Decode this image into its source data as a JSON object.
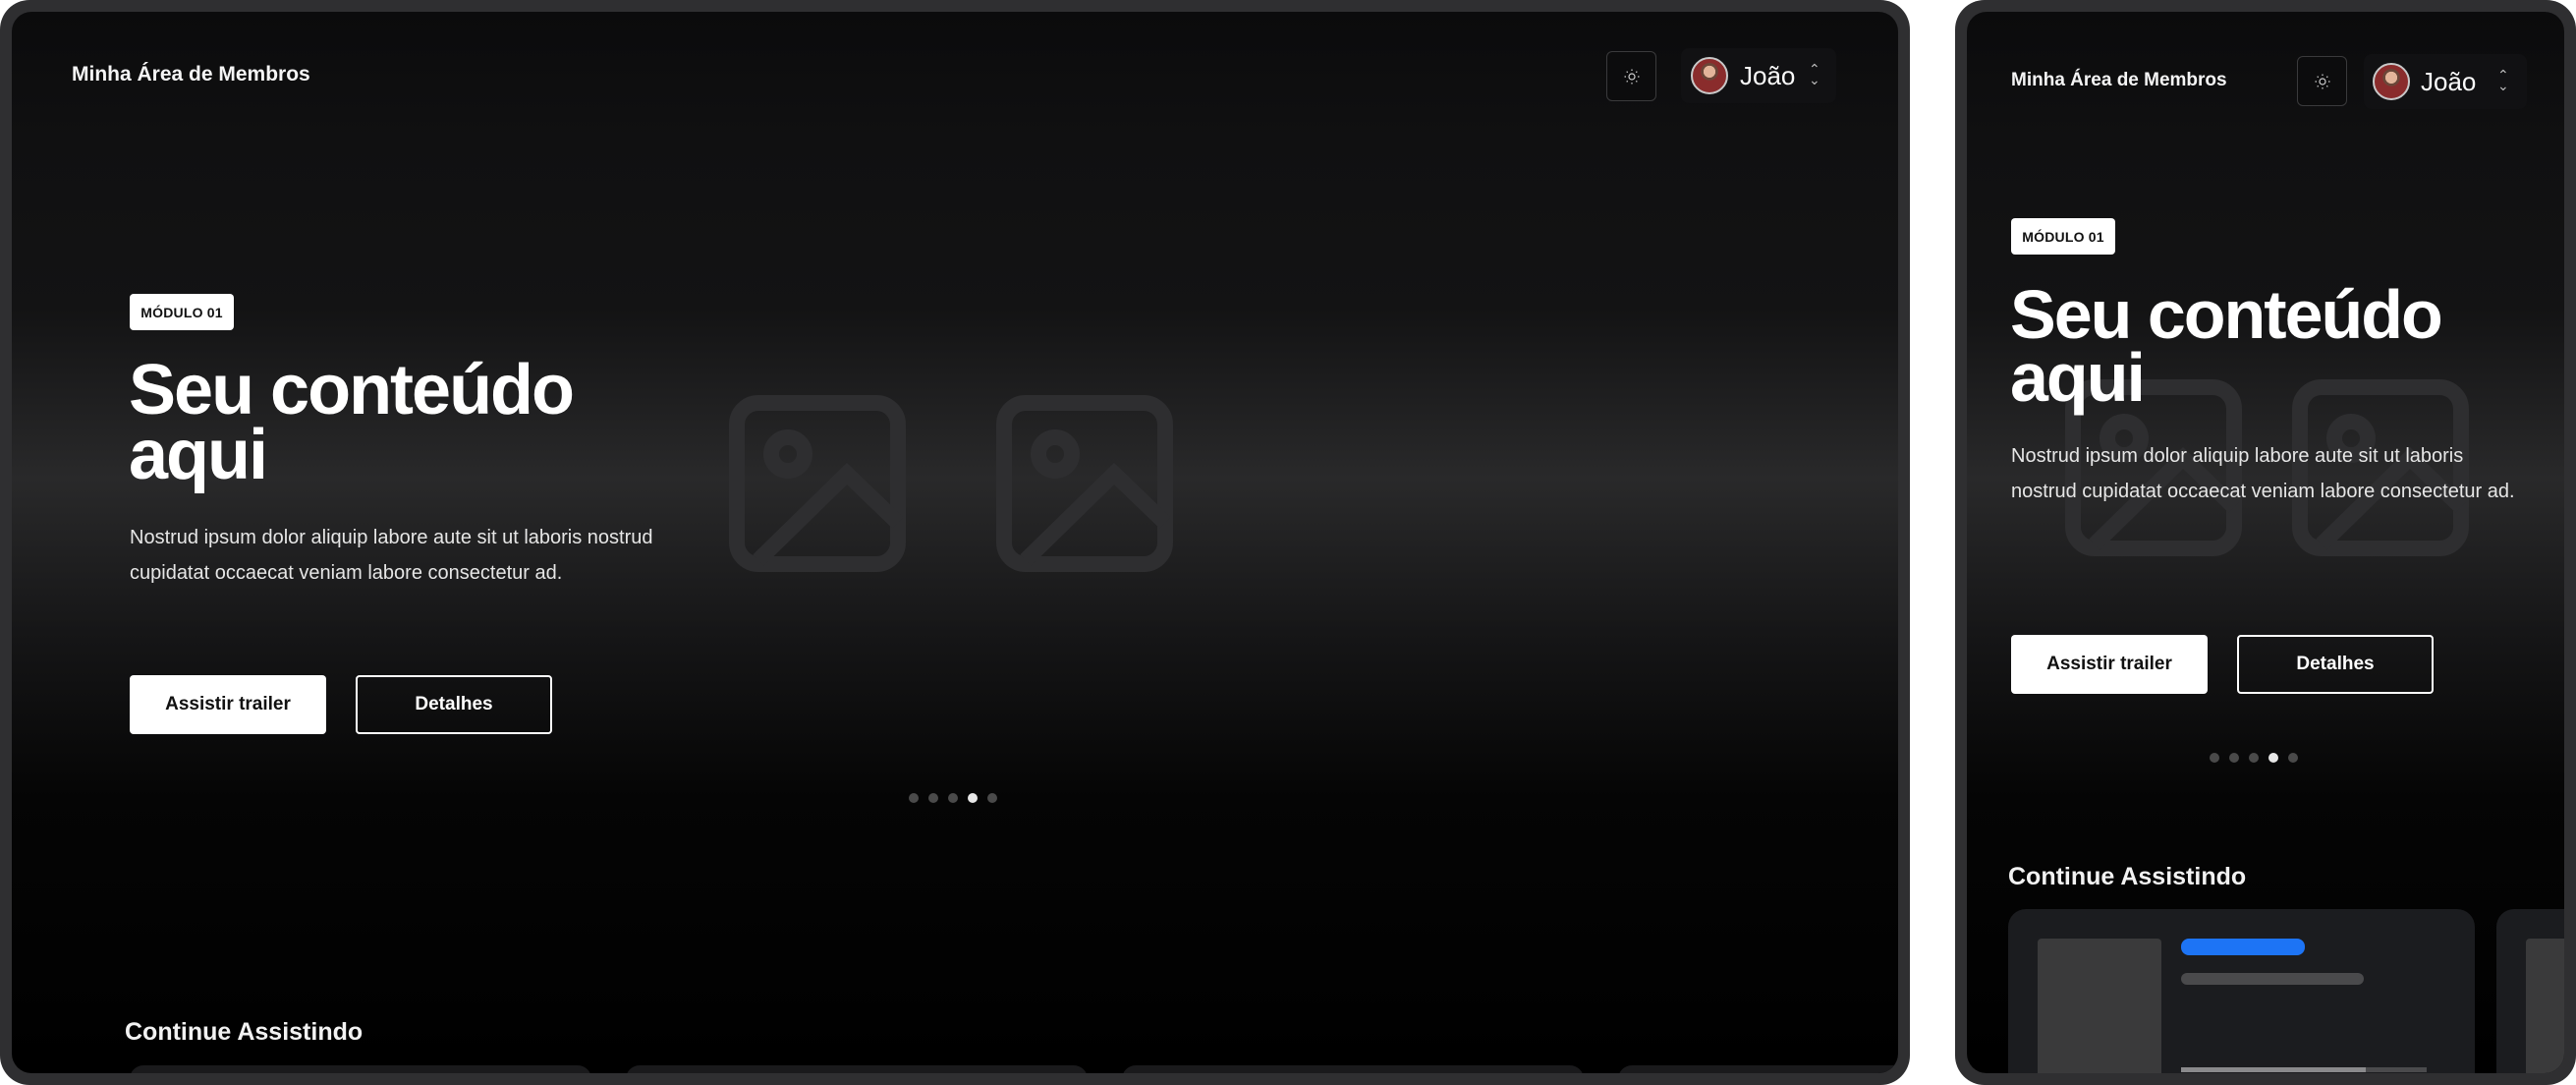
{
  "brand": "Minha Área de Membros",
  "user": {
    "name": "João",
    "avatar_icon": "user-avatar"
  },
  "theme_toggle": {
    "icon": "sun-icon"
  },
  "hero": {
    "badge": "MÓDULO 01",
    "title_line1": "Seu conteúdo",
    "title_line2": "aqui",
    "description": "Nostrud ipsum dolor aliquip labore aute sit ut laboris nostrud cupidatat occaecat veniam labore consectetur ad.",
    "primary_button": "Assistir trailer",
    "secondary_button": "Detalhes",
    "slides_total": 5,
    "active_slide": 4
  },
  "continue_section": {
    "title": "Continue Assistindo"
  },
  "mobile_card": {
    "progress": 0.75
  },
  "colors": {
    "accent": "#1d74f5",
    "background": "#000000",
    "frame": "#2f2f31"
  }
}
